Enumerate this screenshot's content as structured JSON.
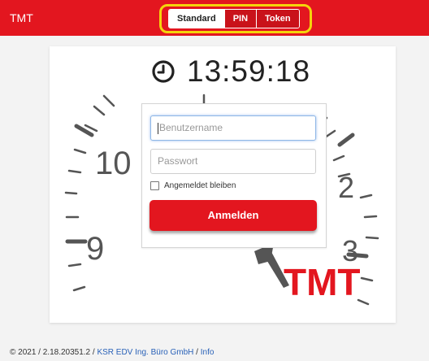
{
  "header": {
    "brand": "TMT",
    "tabs": [
      {
        "label": "Standard",
        "active": true
      },
      {
        "label": "PIN",
        "active": false
      },
      {
        "label": "Token",
        "active": false
      }
    ],
    "accent_color": "#e3161f",
    "highlight_color": "#f4d40b"
  },
  "clock": {
    "icon": "clock-icon",
    "time": "13:59:18"
  },
  "dial": {
    "numbers": [
      "10",
      "9",
      "2",
      "3"
    ],
    "logo_text": "TMT"
  },
  "login": {
    "username_placeholder": "Benutzername",
    "password_placeholder": "Passwort",
    "remember_label": "Angemeldet bleiben",
    "submit_label": "Anmelden"
  },
  "footer": {
    "prefix": "© 2021 / 2.18.20351.2 / ",
    "company_link": "KSR EDV Ing. Büro GmbH",
    "separator": " / ",
    "info_link": "Info"
  }
}
